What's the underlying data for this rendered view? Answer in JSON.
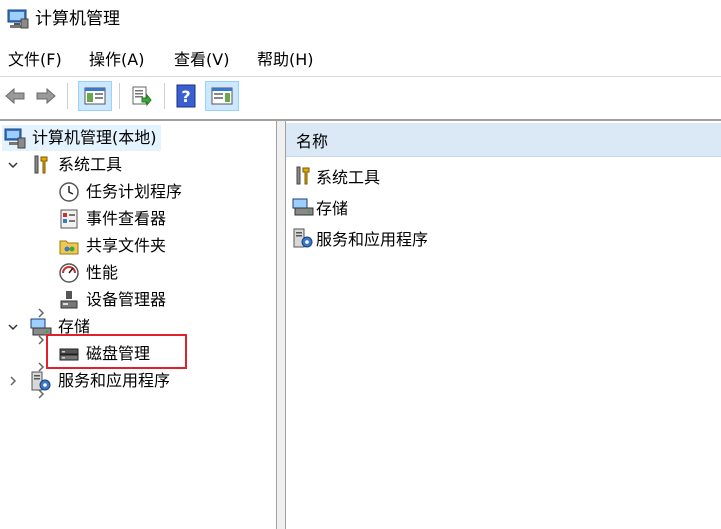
{
  "window": {
    "title": "计算机管理"
  },
  "menu": [
    {
      "label": "文件(F)"
    },
    {
      "label": "操作(A)"
    },
    {
      "label": "查看(V)"
    },
    {
      "label": "帮助(H)"
    }
  ],
  "toolbar": {
    "buttons": [
      "back-icon",
      "forward-icon",
      "show-hide-tree-icon",
      "export-list-icon",
      "help-icon",
      "show-hide-action-pane-icon"
    ]
  },
  "tree": {
    "root": "计算机管理(本地)",
    "system_tools": "系统工具",
    "task_scheduler": "任务计划程序",
    "event_viewer": "事件查看器",
    "shared_folders": "共享文件夹",
    "performance": "性能",
    "device_manager": "设备管理器",
    "storage": "存储",
    "disk_management": "磁盘管理",
    "services_apps": "服务和应用程序"
  },
  "list": {
    "header": "名称",
    "items": [
      "系统工具",
      "存储",
      "服务和应用程序"
    ]
  },
  "colors": {
    "highlight": "#e0202a",
    "selection": "#e5f3ff",
    "header": "#dbe9f6"
  }
}
